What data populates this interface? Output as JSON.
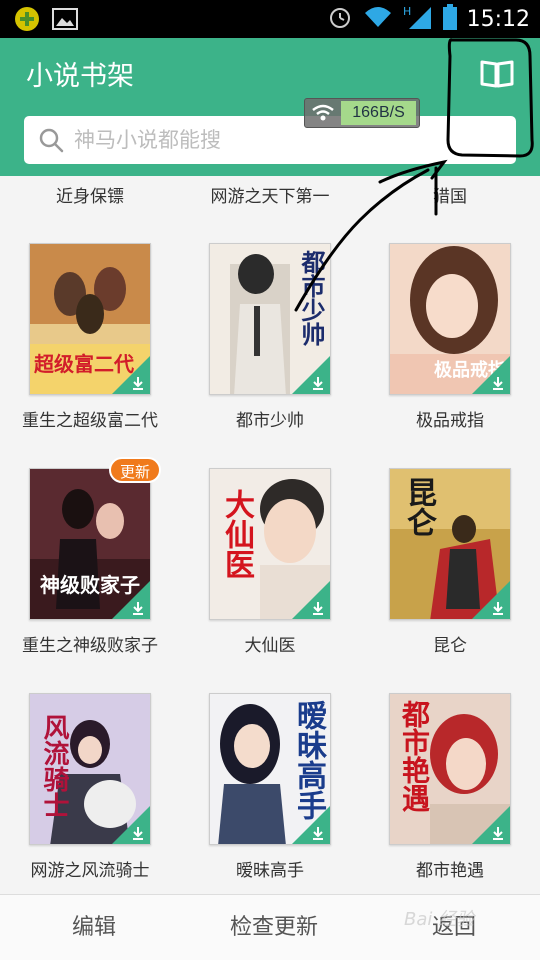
{
  "status_bar": {
    "time": "15:12",
    "network": "H",
    "icons": [
      "app-notification-icon",
      "image-notification-icon",
      "alarm-icon",
      "wifi-icon",
      "signal-icon",
      "battery-icon"
    ]
  },
  "header": {
    "title": "小说书架",
    "search_placeholder": "神马小说都能搜",
    "accent_color": "#3cb389"
  },
  "speed_overlay": {
    "value": "166B/S"
  },
  "shelf": {
    "top_row": [
      "近身保镖",
      "网游之天下第一",
      "猎国"
    ],
    "books": [
      {
        "title": "重生之超级富二代",
        "cover_text": "超级富二代",
        "badge": ""
      },
      {
        "title": "都市少帅",
        "cover_text": "都市少帅",
        "badge": ""
      },
      {
        "title": "极品戒指",
        "cover_text": "极品戒指",
        "badge": ""
      },
      {
        "title": "重生之神级败家子",
        "cover_text": "神级败家子",
        "badge": "更新"
      },
      {
        "title": "大仙医",
        "cover_text": "大仙医",
        "badge": ""
      },
      {
        "title": "昆仑",
        "cover_text": "昆仑",
        "badge": ""
      },
      {
        "title": "网游之风流骑士",
        "cover_text": "风流骑士",
        "badge": ""
      },
      {
        "title": "暧昧高手",
        "cover_text": "暧昧高手",
        "badge": ""
      },
      {
        "title": "都市艳遇",
        "cover_text": "都市艳遇",
        "badge": ""
      }
    ]
  },
  "bottom_bar": {
    "edit": "编辑",
    "check_update": "检查更新",
    "back": "返回"
  },
  "watermark": "Bai 经验"
}
